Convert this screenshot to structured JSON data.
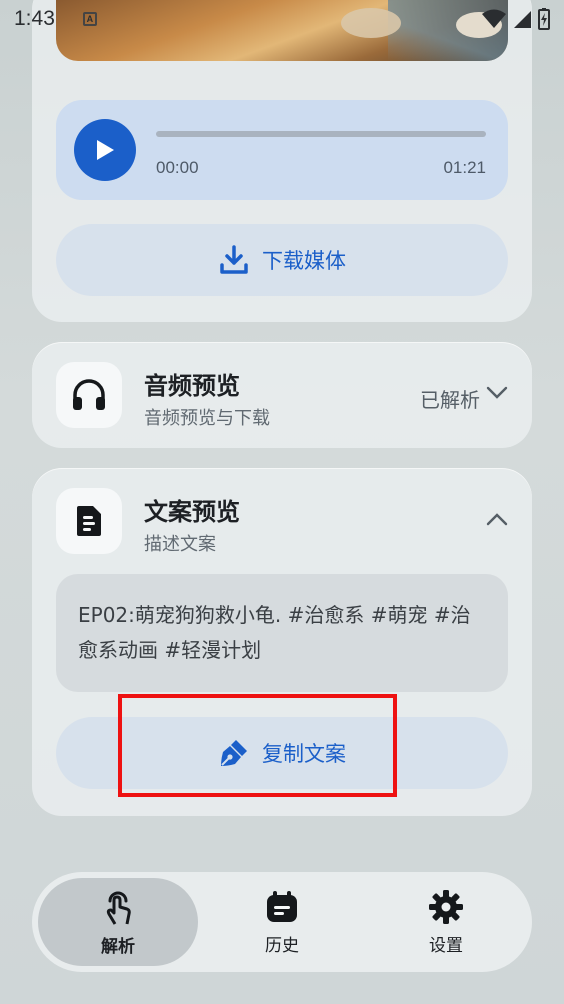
{
  "status_bar": {
    "time": "1:43",
    "sim_label": "A"
  },
  "player": {
    "current_time": "00:00",
    "duration": "01:21",
    "progress": 0
  },
  "media": {
    "download_label": "下载媒体"
  },
  "audio_section": {
    "title": "音频预览",
    "subtitle": "音频预览与下载",
    "status": "已解析",
    "expanded": false
  },
  "copy_section": {
    "title": "文案预览",
    "subtitle": "描述文案",
    "caption": "EP02:萌宠狗狗救小龟. #治愈系 #萌宠 #治愈系动画 #轻漫计划",
    "copy_label": "复制文案",
    "expanded": true
  },
  "nav": {
    "items": [
      {
        "label": "解析",
        "icon": "tap-icon",
        "active": true
      },
      {
        "label": "历史",
        "icon": "calendar-icon",
        "active": false
      },
      {
        "label": "设置",
        "icon": "gear-icon",
        "active": false
      }
    ]
  },
  "colors": {
    "accent": "#1b5fc9",
    "highlight": "#ee1111"
  }
}
